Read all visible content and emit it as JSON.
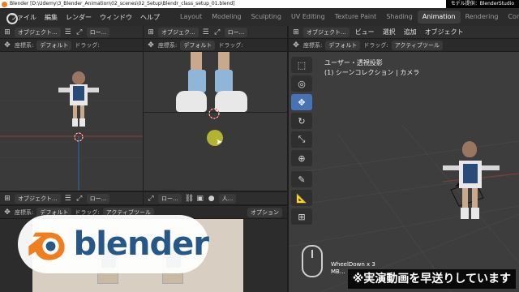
{
  "window": {
    "title": "Blender [D:\\Udemy\\3_Blender_Animation\\02_scenes\\02_Setup\\Blendr_class_setup_01.blend]",
    "credit": "モデル提供：BlenderStudio"
  },
  "menu": {
    "items": [
      "ファイル",
      "編集",
      "レンダー",
      "ウィンドウ",
      "ヘルプ"
    ],
    "workspaces": [
      "Layout",
      "Modeling",
      "Sculpting",
      "UV Editing",
      "Texture Paint",
      "Shading",
      "Animation",
      "Rendering",
      "Compo"
    ],
    "active_workspace": "Animation"
  },
  "viewport_tl": {
    "mode": "オブジェクト...",
    "view": "ロー...",
    "coord_label": "座標系:",
    "coord_value": "デフォルト",
    "drag_label": "ドラッグ:"
  },
  "viewport_tm": {
    "mode": "オブジェク...",
    "view": "ロー...",
    "coord_label": "座標系:",
    "coord_value": "デフォルト",
    "drag_label": "ドラッグ:"
  },
  "viewport_right": {
    "mode": "オブジェクト...",
    "menu_items": [
      "ビュー",
      "選択",
      "追加",
      "オブジェクト"
    ],
    "coord_label": "座標系:",
    "coord_value": "デフォルト",
    "drag_label": "ドラッグ:",
    "drag_value": "アクティブツール",
    "view_name": "ユーザー・透視投影",
    "collection": "(1) シーンコレクション | カメラ"
  },
  "viewport_bl": {
    "mode": "オブジェクト...",
    "view": "ロー...",
    "coord_label": "座標系:",
    "coord_value": "デフォルト",
    "drag_label": "ドラッグ:",
    "drag_value": "アクティブツール",
    "options": "オプション"
  },
  "viewport_bm": {
    "mode": "オブジェクト...",
    "view": "ロー...",
    "person_label": "人..."
  },
  "logo": {
    "text": "blender",
    "orange": "#f07d1e",
    "blue": "#265787"
  },
  "input_indicator": {
    "line1": "WheelDown x 3",
    "line2": "MB..."
  },
  "subtitle": "※実演動画を早送りしています",
  "colors": {
    "accent": "#4772b3",
    "cursor_highlight": "#c8c832"
  }
}
